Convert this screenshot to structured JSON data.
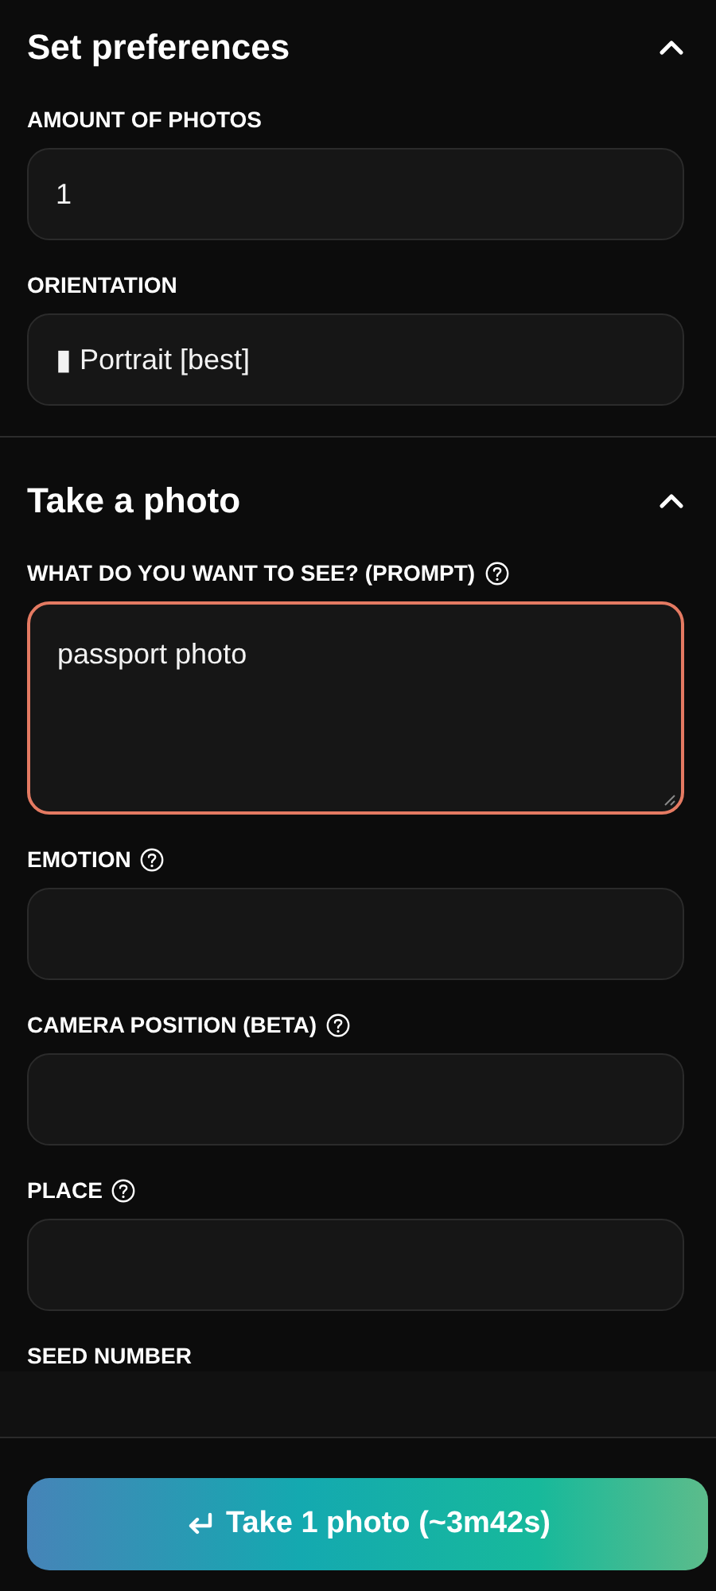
{
  "sections": [
    {
      "title": "Set preferences",
      "expanded": true,
      "fields": [
        {
          "label": "AMOUNT OF PHOTOS",
          "help": false,
          "kind": "input",
          "value": "1",
          "focused": false
        },
        {
          "label": "ORIENTATION",
          "help": false,
          "kind": "input",
          "value": "▮ Portrait [best]",
          "focused": false
        }
      ]
    },
    {
      "title": "Take a photo",
      "expanded": true,
      "fields": [
        {
          "label": "WHAT DO YOU WANT TO SEE? (PROMPT)",
          "help": true,
          "kind": "textarea",
          "value": "passport photo",
          "focused": true
        },
        {
          "label": "EMOTION",
          "help": true,
          "kind": "input",
          "focused": false
        },
        {
          "label": "CAMERA POSITION (BETA)",
          "help": true,
          "kind": "input",
          "focused": false
        },
        {
          "label": "PLACE",
          "help": true,
          "kind": "input",
          "focused": false
        },
        {
          "label": "SEED NUMBER",
          "help": false,
          "kind": "cut"
        }
      ]
    }
  ],
  "submit": {
    "label": "Take 1 photo (~3m42s)"
  }
}
